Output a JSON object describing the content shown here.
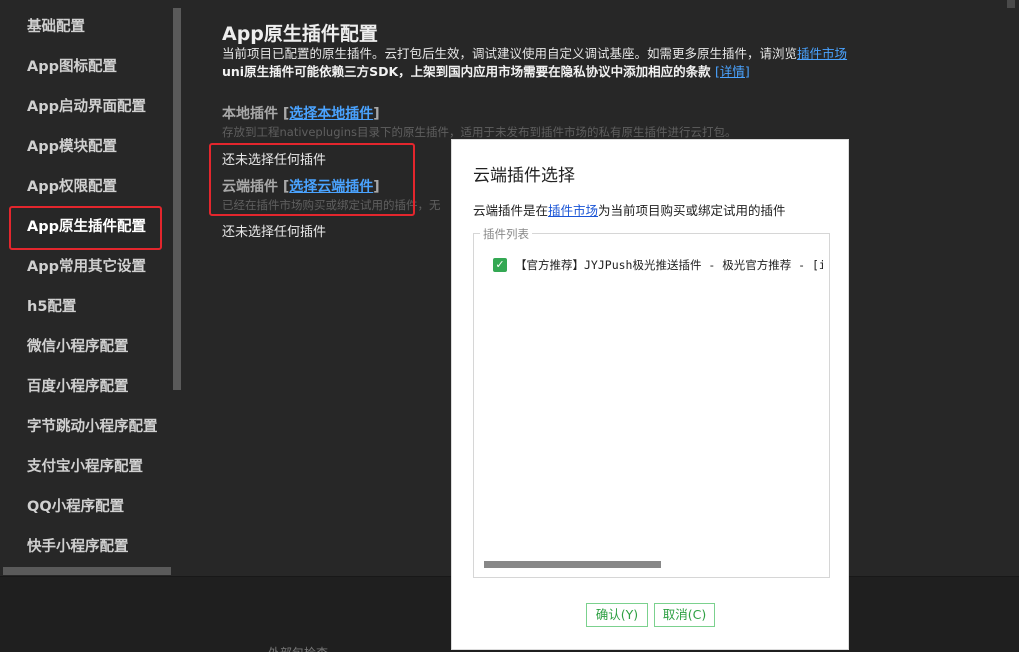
{
  "sidebar": {
    "items": [
      {
        "label": "基础配置"
      },
      {
        "label": "App图标配置"
      },
      {
        "label": "App启动界面配置"
      },
      {
        "label": "App模块配置"
      },
      {
        "label": "App权限配置"
      },
      {
        "label": "App原生插件配置",
        "active": true
      },
      {
        "label": "App常用其它设置"
      },
      {
        "label": "h5配置"
      },
      {
        "label": "微信小程序配置"
      },
      {
        "label": "百度小程序配置"
      },
      {
        "label": "字节跳动小程序配置"
      },
      {
        "label": "支付宝小程序配置"
      },
      {
        "label": "QQ小程序配置"
      },
      {
        "label": "快手小程序配置"
      }
    ]
  },
  "main": {
    "title": "App原生插件配置",
    "desc_line1": "当前项目已配置的原生插件。云打包后生效，调试建议使用自定义调试基座。如需更多原生插件，请浏览",
    "desc_line1_link": "插件市场",
    "desc_line2": "uni原生插件可能依赖三方SDK，上架到国内应用市场需要在隐私协议中添加相应的条款",
    "desc_line2_link": "[详情]",
    "local_section": {
      "title": "本地插件",
      "bracket_open": "[",
      "link": "选择本地插件",
      "bracket_close": "]",
      "hint": "存放到工程nativeplugins目录下的原生插件，适用于未发布到插件市场的私有原生插件进行云打包。",
      "empty": "还未选择任何插件"
    },
    "cloud_section": {
      "title": "云端插件",
      "bracket_open": "[",
      "link": "选择云端插件",
      "bracket_close": "]",
      "hint": "已经在插件市场购买或绑定试用的插件，无",
      "empty": "还未选择任何插件"
    }
  },
  "dialog": {
    "title": "云端插件选择",
    "desc_prefix": "云端插件是在",
    "desc_link": "插件市场",
    "desc_suffix": "为当前项目购买或绑定试用的插件",
    "list_legend": "插件列表",
    "plugins": [
      {
        "label": "【官方推荐】JYJPush极光推送插件 - 极光官方推荐 - [i",
        "checked": true
      }
    ],
    "confirm_label": "确认(Y)",
    "cancel_label": "取消(C)"
  },
  "bottom_panel": {
    "partial_text": "外部包检查"
  },
  "colors": {
    "accent_red": "#e3262d",
    "link_blue": "#4aa3ff",
    "button_green": "#2ea043",
    "checkbox_green": "#34a853"
  }
}
